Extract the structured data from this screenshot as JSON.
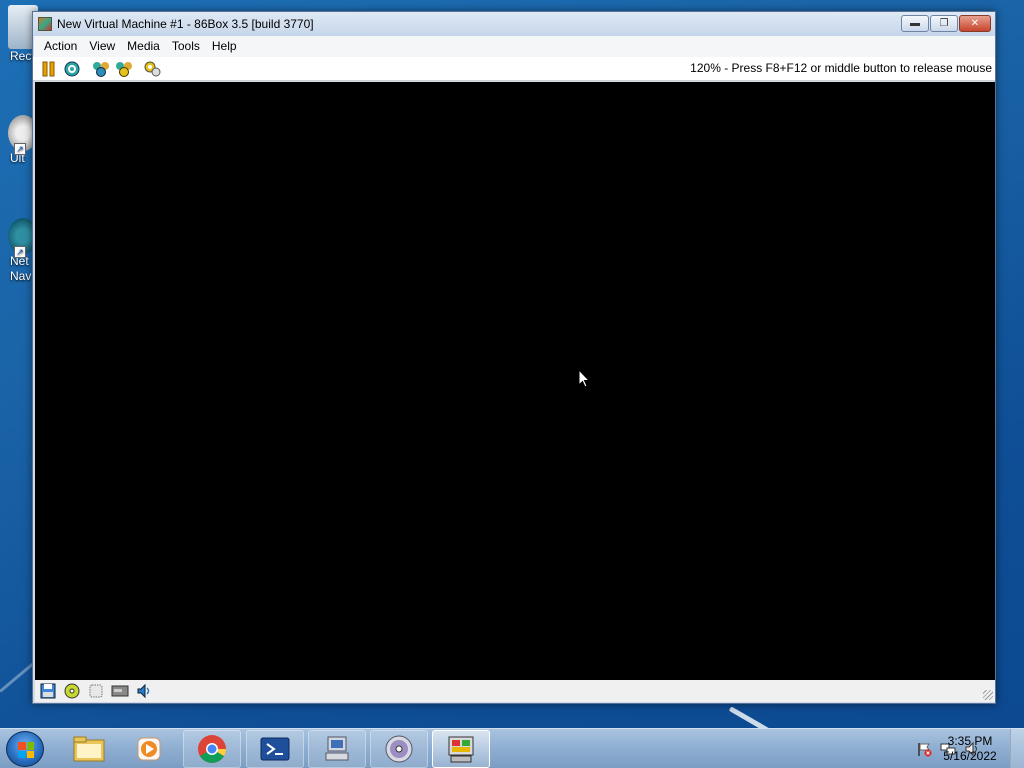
{
  "desktop": {
    "icons": [
      {
        "name": "recycle-bin-icon",
        "label": "Recy"
      },
      {
        "name": "ult-icon",
        "label": "Ult"
      },
      {
        "name": "netscape-navigator-icon",
        "label": "Net Nav"
      }
    ]
  },
  "window": {
    "title": "New Virtual Machine #1 - 86Box 3.5 [build 3770]",
    "controls": {
      "minimize": "minimize-icon",
      "maximize": "maximize-icon",
      "close": "close-icon"
    },
    "menu": [
      "Action",
      "View",
      "Media",
      "Tools",
      "Help"
    ],
    "toolbar": {
      "buttons": [
        "pause-icon",
        "hard-reset-icon",
        "ctrl-alt-del-icon",
        "ctrl-alt-esc-icon",
        "settings-icon"
      ],
      "status": "120% - Press F8+F12 or middle button to release mouse"
    },
    "statusbar": {
      "icons": [
        "floppy-icon",
        "cdrom-icon",
        "zip-icon",
        "hard-disk-icon",
        "sound-icon"
      ]
    }
  },
  "taskbar": {
    "apps": [
      {
        "name": "file-explorer-icon",
        "state": "pinned"
      },
      {
        "name": "media-player-icon",
        "state": "pinned"
      },
      {
        "name": "chrome-icon",
        "state": "running"
      },
      {
        "name": "powershell-icon",
        "state": "running"
      },
      {
        "name": "virtual-pc-icon",
        "state": "running"
      },
      {
        "name": "dvd-maker-icon",
        "state": "running"
      },
      {
        "name": "86box-icon",
        "state": "active"
      }
    ],
    "tray": [
      "action-center-flag-icon",
      "network-icon",
      "volume-icon"
    ],
    "clock": {
      "time": "3:35 PM",
      "date": "5/16/2022"
    }
  },
  "colors": {
    "desktop": "#1a63a6",
    "screen": "#000000",
    "titlebar": "#cfdcec",
    "close": "#c7452d"
  }
}
